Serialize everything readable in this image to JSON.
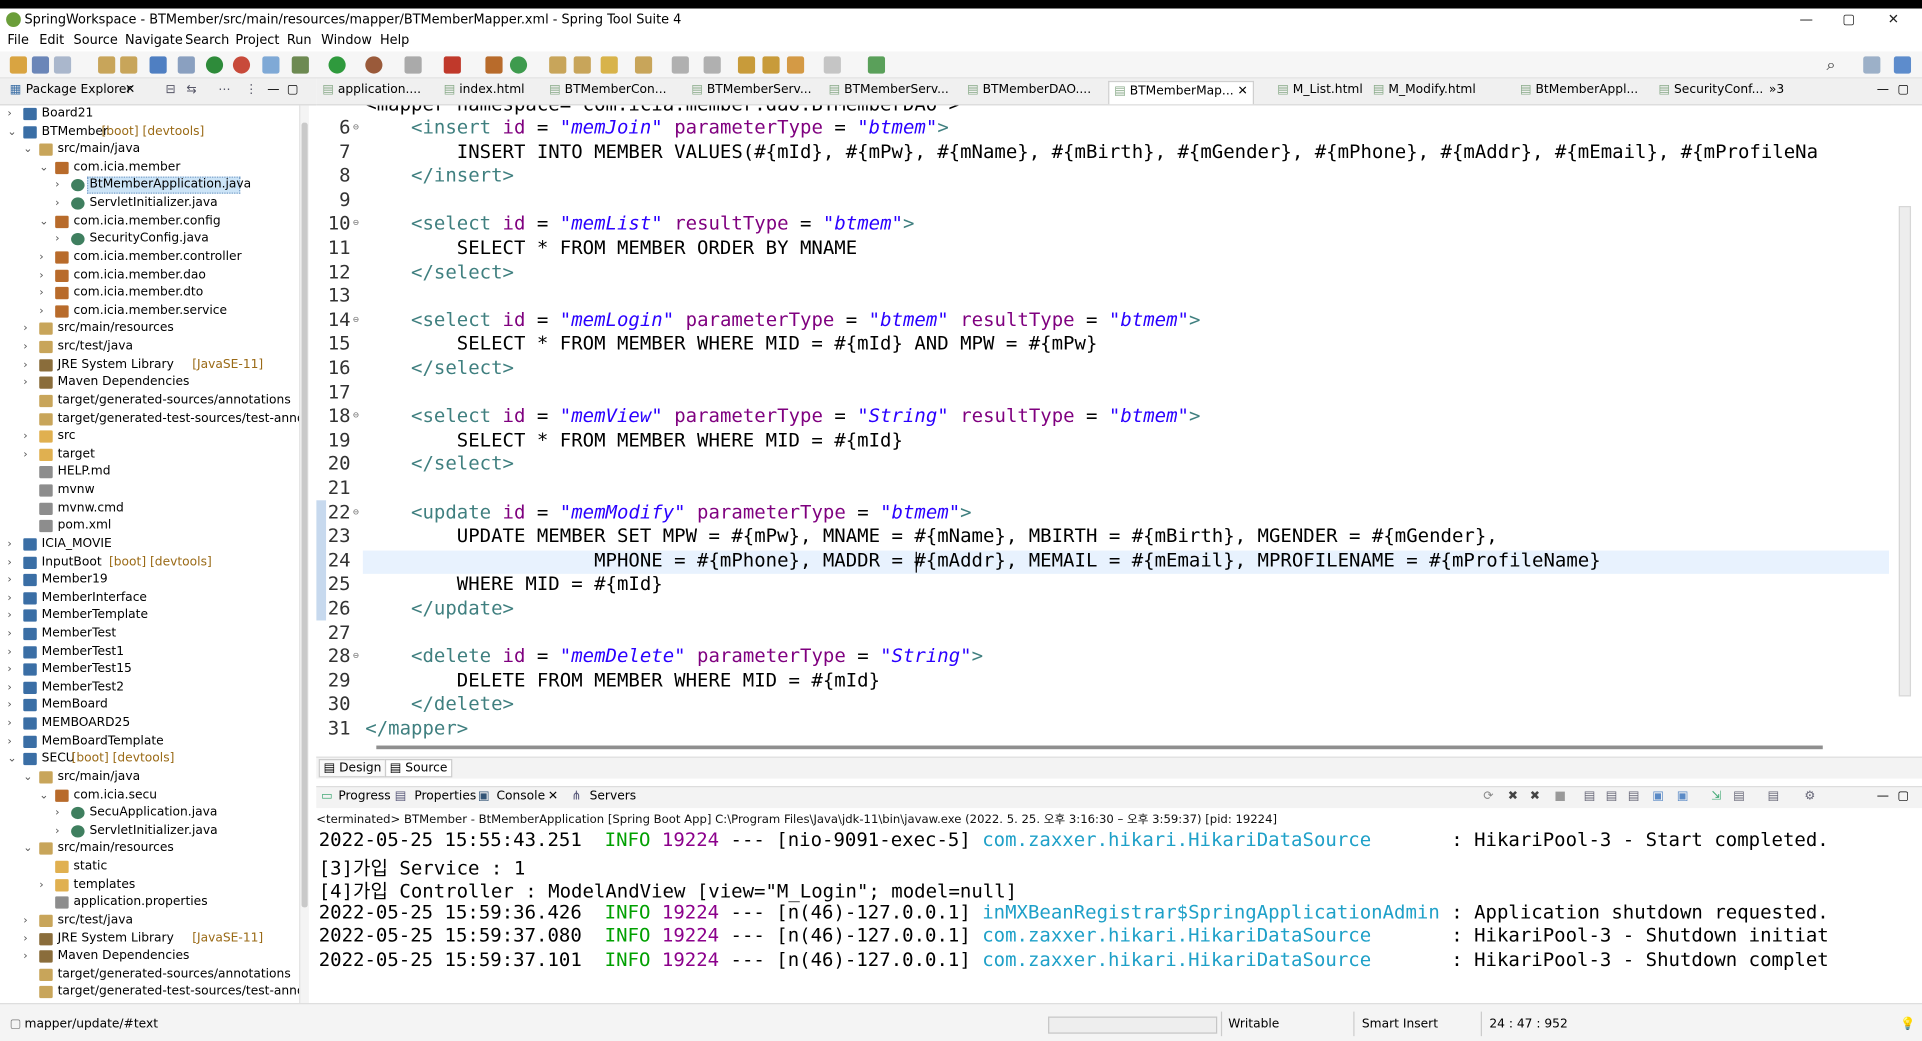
{
  "window": {
    "title": "SpringWorkspace - BTMember/src/main/resources/mapper/BTMemberMapper.xml - Spring Tool Suite 4",
    "controls": [
      "—",
      "▢",
      "✕"
    ]
  },
  "menu": [
    "File",
    "Edit",
    "Source",
    "Navigate",
    "Search",
    "Project",
    "Run",
    "Window",
    "Help"
  ],
  "explorer": {
    "title": "Package Explorer",
    "items": [
      {
        "label": "Board21",
        "deco": "",
        "level": 0,
        "toggle": "›",
        "icon": "project"
      },
      {
        "label": "BTMember",
        "deco": " [boot] [devtools]",
        "level": 0,
        "toggle": "⌄",
        "icon": "project"
      },
      {
        "label": "src/main/java",
        "deco": "",
        "level": 1,
        "toggle": "⌄",
        "icon": "srcfolder"
      },
      {
        "label": "com.icia.member",
        "deco": "",
        "level": 2,
        "toggle": "⌄",
        "icon": "package"
      },
      {
        "label": "BtMemberApplication.java",
        "deco": "",
        "level": 3,
        "toggle": "›",
        "icon": "java",
        "selected": true
      },
      {
        "label": "ServletInitializer.java",
        "deco": "",
        "level": 3,
        "toggle": "›",
        "icon": "java"
      },
      {
        "label": "com.icia.member.config",
        "deco": "",
        "level": 2,
        "toggle": "⌄",
        "icon": "package"
      },
      {
        "label": "SecurityConfig.java",
        "deco": "",
        "level": 3,
        "toggle": "›",
        "icon": "java"
      },
      {
        "label": "com.icia.member.controller",
        "deco": "",
        "level": 2,
        "toggle": "›",
        "icon": "package"
      },
      {
        "label": "com.icia.member.dao",
        "deco": "",
        "level": 2,
        "toggle": "›",
        "icon": "package"
      },
      {
        "label": "com.icia.member.dto",
        "deco": "",
        "level": 2,
        "toggle": "›",
        "icon": "package"
      },
      {
        "label": "com.icia.member.service",
        "deco": "",
        "level": 2,
        "toggle": "›",
        "icon": "package"
      },
      {
        "label": "src/main/resources",
        "deco": "",
        "level": 1,
        "toggle": "›",
        "icon": "srcfolder"
      },
      {
        "label": "src/test/java",
        "deco": "",
        "level": 1,
        "toggle": "›",
        "icon": "srcfolder"
      },
      {
        "label": "JRE System Library",
        "deco": " [JavaSE-11]",
        "level": 1,
        "toggle": "›",
        "icon": "library"
      },
      {
        "label": "Maven Dependencies",
        "deco": "",
        "level": 1,
        "toggle": "›",
        "icon": "library"
      },
      {
        "label": "target/generated-sources/annotations",
        "deco": "",
        "level": 1,
        "toggle": "",
        "icon": "srcfolder"
      },
      {
        "label": "target/generated-test-sources/test-annotatic",
        "deco": "",
        "level": 1,
        "toggle": "",
        "icon": "srcfolder"
      },
      {
        "label": "src",
        "deco": "",
        "level": 1,
        "toggle": "›",
        "icon": "folder"
      },
      {
        "label": "target",
        "deco": "",
        "level": 1,
        "toggle": "›",
        "icon": "folder"
      },
      {
        "label": "HELP.md",
        "deco": "",
        "level": 1,
        "toggle": "",
        "icon": "file"
      },
      {
        "label": "mvnw",
        "deco": "",
        "level": 1,
        "toggle": "",
        "icon": "file"
      },
      {
        "label": "mvnw.cmd",
        "deco": "",
        "level": 1,
        "toggle": "",
        "icon": "file"
      },
      {
        "label": "pom.xml",
        "deco": "",
        "level": 1,
        "toggle": "",
        "icon": "file"
      },
      {
        "label": "ICIA_MOVIE",
        "deco": "",
        "level": 0,
        "toggle": "›",
        "icon": "project"
      },
      {
        "label": "InputBoot",
        "deco": " [boot] [devtools]",
        "level": 0,
        "toggle": "›",
        "icon": "project"
      },
      {
        "label": "Member19",
        "deco": "",
        "level": 0,
        "toggle": "›",
        "icon": "project"
      },
      {
        "label": "MemberInterface",
        "deco": "",
        "level": 0,
        "toggle": "›",
        "icon": "project"
      },
      {
        "label": "MemberTemplate",
        "deco": "",
        "level": 0,
        "toggle": "›",
        "icon": "project"
      },
      {
        "label": "MemberTest",
        "deco": "",
        "level": 0,
        "toggle": "›",
        "icon": "project"
      },
      {
        "label": "MemberTest1",
        "deco": "",
        "level": 0,
        "toggle": "›",
        "icon": "project"
      },
      {
        "label": "MemberTest15",
        "deco": "",
        "level": 0,
        "toggle": "›",
        "icon": "project"
      },
      {
        "label": "MemberTest2",
        "deco": "",
        "level": 0,
        "toggle": "›",
        "icon": "project"
      },
      {
        "label": "MemBoard",
        "deco": "",
        "level": 0,
        "toggle": "›",
        "icon": "project"
      },
      {
        "label": "MEMBOARD25",
        "deco": "",
        "level": 0,
        "toggle": "›",
        "icon": "project"
      },
      {
        "label": "MemBoardTemplate",
        "deco": "",
        "level": 0,
        "toggle": "›",
        "icon": "project"
      },
      {
        "label": "SECU",
        "deco": " [boot] [devtools]",
        "level": 0,
        "toggle": "⌄",
        "icon": "project"
      },
      {
        "label": "src/main/java",
        "deco": "",
        "level": 1,
        "toggle": "⌄",
        "icon": "srcfolder"
      },
      {
        "label": "com.icia.secu",
        "deco": "",
        "level": 2,
        "toggle": "⌄",
        "icon": "package"
      },
      {
        "label": "SecuApplication.java",
        "deco": "",
        "level": 3,
        "toggle": "›",
        "icon": "java"
      },
      {
        "label": "ServletInitializer.java",
        "deco": "",
        "level": 3,
        "toggle": "›",
        "icon": "java"
      },
      {
        "label": "src/main/resources",
        "deco": "",
        "level": 1,
        "toggle": "⌄",
        "icon": "srcfolder"
      },
      {
        "label": "static",
        "deco": "",
        "level": 2,
        "toggle": "",
        "icon": "folder"
      },
      {
        "label": "templates",
        "deco": "",
        "level": 2,
        "toggle": "›",
        "icon": "folder"
      },
      {
        "label": "application.properties",
        "deco": "",
        "level": 2,
        "toggle": "",
        "icon": "file"
      },
      {
        "label": "src/test/java",
        "deco": "",
        "level": 1,
        "toggle": "›",
        "icon": "srcfolder"
      },
      {
        "label": "JRE System Library",
        "deco": " [JavaSE-11]",
        "level": 1,
        "toggle": "›",
        "icon": "library"
      },
      {
        "label": "Maven Dependencies",
        "deco": "",
        "level": 1,
        "toggle": "›",
        "icon": "library"
      },
      {
        "label": "target/generated-sources/annotations",
        "deco": "",
        "level": 1,
        "toggle": "",
        "icon": "srcfolder"
      },
      {
        "label": "target/generated-test-sources/test-annotatic",
        "deco": "",
        "level": 1,
        "toggle": "",
        "icon": "srcfolder"
      }
    ]
  },
  "editor_tabs": [
    {
      "label": "application....",
      "active": false
    },
    {
      "label": "index.html",
      "active": false
    },
    {
      "label": "BTMemberCon...",
      "active": false
    },
    {
      "label": "BTMemberServ...",
      "active": false
    },
    {
      "label": "BTMemberServ...",
      "active": false
    },
    {
      "label": "BTMemberDAO....",
      "active": false
    },
    {
      "label": "BTMemberMap...",
      "active": true
    },
    {
      "label": "M_List.html",
      "active": false
    },
    {
      "label": "M_Modify.html",
      "active": false
    },
    {
      "label": "BtMemberAppl...",
      "active": false
    },
    {
      "label": "SecurityConf...",
      "active": false
    }
  ],
  "editor_overflow": "»3",
  "editor": {
    "top_partial": "<mapper namespace=\"com.icia.member.dao.BTMemberDAO\">",
    "lines": [
      {
        "n": "6",
        "fold": true,
        "segs": [
          [
            "    ",
            ""
          ],
          [
            "<insert ",
            "tg"
          ],
          [
            "id",
            " at"
          ],
          [
            " = ",
            ""
          ],
          [
            "\"memJoin\"",
            "sv"
          ],
          [
            " ",
            ""
          ],
          [
            "parameterType",
            "at"
          ],
          [
            " = ",
            ""
          ],
          [
            "\"btmem\"",
            "sv"
          ],
          [
            ">",
            "tg"
          ]
        ]
      },
      {
        "n": "7",
        "fold": false,
        "segs": [
          [
            "        INSERT INTO MEMBER VALUES(#{mId}, #{mPw}, #{mName}, #{mBirth}, #{mGender}, #{mPhone}, #{mAddr}, #{mEmail}, #{mProfileNa",
            ""
          ]
        ]
      },
      {
        "n": "8",
        "fold": false,
        "segs": [
          [
            "    ",
            ""
          ],
          [
            "</insert>",
            "tg"
          ]
        ]
      },
      {
        "n": "9",
        "fold": false,
        "segs": [
          [
            "",
            ""
          ]
        ]
      },
      {
        "n": "10",
        "fold": true,
        "segs": [
          [
            "    ",
            ""
          ],
          [
            "<select ",
            "tg"
          ],
          [
            "id",
            "at"
          ],
          [
            " = ",
            ""
          ],
          [
            "\"memList\"",
            "sv"
          ],
          [
            " ",
            ""
          ],
          [
            "resultType",
            "at"
          ],
          [
            " = ",
            ""
          ],
          [
            "\"btmem\"",
            "sv"
          ],
          [
            ">",
            "tg"
          ]
        ]
      },
      {
        "n": "11",
        "fold": false,
        "segs": [
          [
            "        SELECT * FROM MEMBER ORDER BY MNAME",
            ""
          ]
        ]
      },
      {
        "n": "12",
        "fold": false,
        "segs": [
          [
            "    ",
            ""
          ],
          [
            "</select>",
            "tg"
          ]
        ]
      },
      {
        "n": "13",
        "fold": false,
        "segs": [
          [
            "",
            ""
          ]
        ]
      },
      {
        "n": "14",
        "fold": true,
        "segs": [
          [
            "    ",
            ""
          ],
          [
            "<select ",
            "tg"
          ],
          [
            "id",
            "at"
          ],
          [
            " = ",
            ""
          ],
          [
            "\"memLogin\"",
            "sv"
          ],
          [
            " ",
            ""
          ],
          [
            "parameterType",
            "at"
          ],
          [
            " = ",
            ""
          ],
          [
            "\"btmem\"",
            "sv"
          ],
          [
            " ",
            ""
          ],
          [
            "resultType",
            "at"
          ],
          [
            " = ",
            ""
          ],
          [
            "\"btmem\"",
            "sv"
          ],
          [
            ">",
            "tg"
          ]
        ]
      },
      {
        "n": "15",
        "fold": false,
        "segs": [
          [
            "        SELECT * FROM MEMBER WHERE MID = #{mId} AND MPW = #{mPw}",
            ""
          ]
        ]
      },
      {
        "n": "16",
        "fold": false,
        "segs": [
          [
            "    ",
            ""
          ],
          [
            "</select>",
            "tg"
          ]
        ]
      },
      {
        "n": "17",
        "fold": false,
        "segs": [
          [
            "",
            ""
          ]
        ]
      },
      {
        "n": "18",
        "fold": true,
        "segs": [
          [
            "    ",
            ""
          ],
          [
            "<select ",
            "tg"
          ],
          [
            "id",
            "at"
          ],
          [
            " = ",
            ""
          ],
          [
            "\"memView\"",
            "sv"
          ],
          [
            " ",
            ""
          ],
          [
            "parameterType",
            "at"
          ],
          [
            " = ",
            ""
          ],
          [
            "\"String\"",
            "sv"
          ],
          [
            " ",
            ""
          ],
          [
            "resultType",
            "at"
          ],
          [
            " = ",
            ""
          ],
          [
            "\"btmem\"",
            "sv"
          ],
          [
            ">",
            "tg"
          ]
        ]
      },
      {
        "n": "19",
        "fold": false,
        "segs": [
          [
            "        SELECT * FROM MEMBER WHERE MID = #{mId}",
            ""
          ]
        ]
      },
      {
        "n": "20",
        "fold": false,
        "segs": [
          [
            "    ",
            ""
          ],
          [
            "</select>",
            "tg"
          ]
        ]
      },
      {
        "n": "21",
        "fold": false,
        "segs": [
          [
            "",
            ""
          ]
        ]
      },
      {
        "n": "22",
        "fold": true,
        "segs": [
          [
            "    ",
            ""
          ],
          [
            "<update ",
            "tg"
          ],
          [
            "id",
            "at"
          ],
          [
            " = ",
            ""
          ],
          [
            "\"memModify\"",
            "sv"
          ],
          [
            " ",
            ""
          ],
          [
            "parameterType",
            "at"
          ],
          [
            " = ",
            ""
          ],
          [
            "\"btmem\"",
            "sv"
          ],
          [
            ">",
            "tg"
          ]
        ]
      },
      {
        "n": "23",
        "fold": false,
        "segs": [
          [
            "        UPDATE MEMBER SET MPW = #{mPw}, MNAME = #{mName}, MBIRTH = #{mBirth}, MGENDER = #{mGender},",
            ""
          ]
        ]
      },
      {
        "n": "24",
        "fold": false,
        "segs": [
          [
            "                    MPHONE = #{mPhone}, MADDR = #{mAddr}, MEMAIL = #{mEmail}, MPROFILENAME = #{mProfileName}",
            ""
          ]
        ]
      },
      {
        "n": "25",
        "fold": false,
        "segs": [
          [
            "        WHERE MID = #{mId}",
            ""
          ]
        ]
      },
      {
        "n": "26",
        "fold": false,
        "segs": [
          [
            "    ",
            ""
          ],
          [
            "</update>",
            "tg"
          ]
        ]
      },
      {
        "n": "27",
        "fold": false,
        "segs": [
          [
            "",
            ""
          ]
        ]
      },
      {
        "n": "28",
        "fold": true,
        "segs": [
          [
            "    ",
            ""
          ],
          [
            "<delete ",
            "tg"
          ],
          [
            "id",
            "at"
          ],
          [
            " = ",
            ""
          ],
          [
            "\"memDelete\"",
            "sv"
          ],
          [
            " ",
            ""
          ],
          [
            "parameterType",
            "at"
          ],
          [
            " = ",
            ""
          ],
          [
            "\"String\"",
            "sv"
          ],
          [
            ">",
            "tg"
          ]
        ]
      },
      {
        "n": "29",
        "fold": false,
        "segs": [
          [
            "        DELETE FROM MEMBER WHERE MID = #{mId}",
            ""
          ]
        ]
      },
      {
        "n": "30",
        "fold": false,
        "segs": [
          [
            "    ",
            ""
          ],
          [
            "</delete>",
            "tg"
          ]
        ]
      },
      {
        "n": "31",
        "fold": false,
        "segs": [
          [
            "</mapper>",
            "tg"
          ]
        ]
      }
    ],
    "current_line": "24"
  },
  "source_tabs": [
    "Design",
    "Source"
  ],
  "console_tabs": [
    "Progress",
    "Properties",
    "Console",
    "Servers"
  ],
  "console_status": "<terminated> BTMember - BtMemberApplication [Spring Boot App] C:\\Program Files\\Java\\jdk-11\\bin\\javaw.exe  (2022. 5. 25. 오후 3:16:30 – 오후 3:59:37) [pid: 19224]",
  "console_lines": [
    [
      [
        "2022-05-25 15:55:43.251  ",
        ""
      ],
      [
        "INFO",
        "info"
      ],
      [
        " ",
        ""
      ],
      [
        "19224",
        "pid"
      ],
      [
        " --- [nio-9091-exec-5] ",
        ""
      ],
      [
        "com.zaxxer.hikari.HikariDataSource      ",
        "cls"
      ],
      [
        " : HikariPool-3 - Start completed.",
        ""
      ]
    ],
    [
      [
        "[3]가입 Service : 1",
        ""
      ]
    ],
    [
      [
        "[4]가입 Controller : ModelAndView [view=\"M_Login\"; model=null]",
        ""
      ]
    ],
    [
      [
        "2022-05-25 15:59:36.426  ",
        ""
      ],
      [
        "INFO",
        "info"
      ],
      [
        " ",
        ""
      ],
      [
        "19224",
        "pid"
      ],
      [
        " --- [n(46)-127.0.0.1] ",
        ""
      ],
      [
        "inMXBeanRegistrar$SpringApplicationAdmin",
        "cls"
      ],
      [
        " : Application shutdown requested.",
        ""
      ]
    ],
    [
      [
        "2022-05-25 15:59:37.080  ",
        ""
      ],
      [
        "INFO",
        "info"
      ],
      [
        " ",
        ""
      ],
      [
        "19224",
        "pid"
      ],
      [
        " --- [n(46)-127.0.0.1] ",
        ""
      ],
      [
        "com.zaxxer.hikari.HikariDataSource      ",
        "cls"
      ],
      [
        " : HikariPool-3 - Shutdown initiat",
        ""
      ]
    ],
    [
      [
        "2022-05-25 15:59:37.101  ",
        ""
      ],
      [
        "INFO",
        "info"
      ],
      [
        " ",
        ""
      ],
      [
        "19224",
        "pid"
      ],
      [
        " --- [n(46)-127.0.0.1] ",
        ""
      ],
      [
        "com.zaxxer.hikari.HikariDataSource      ",
        "cls"
      ],
      [
        " : HikariPool-3 - Shutdown complet",
        ""
      ]
    ]
  ],
  "status": {
    "path": "mapper/update/#text",
    "mode": "Writable",
    "insert": "Smart Insert",
    "position": "24 : 47 : 952"
  }
}
